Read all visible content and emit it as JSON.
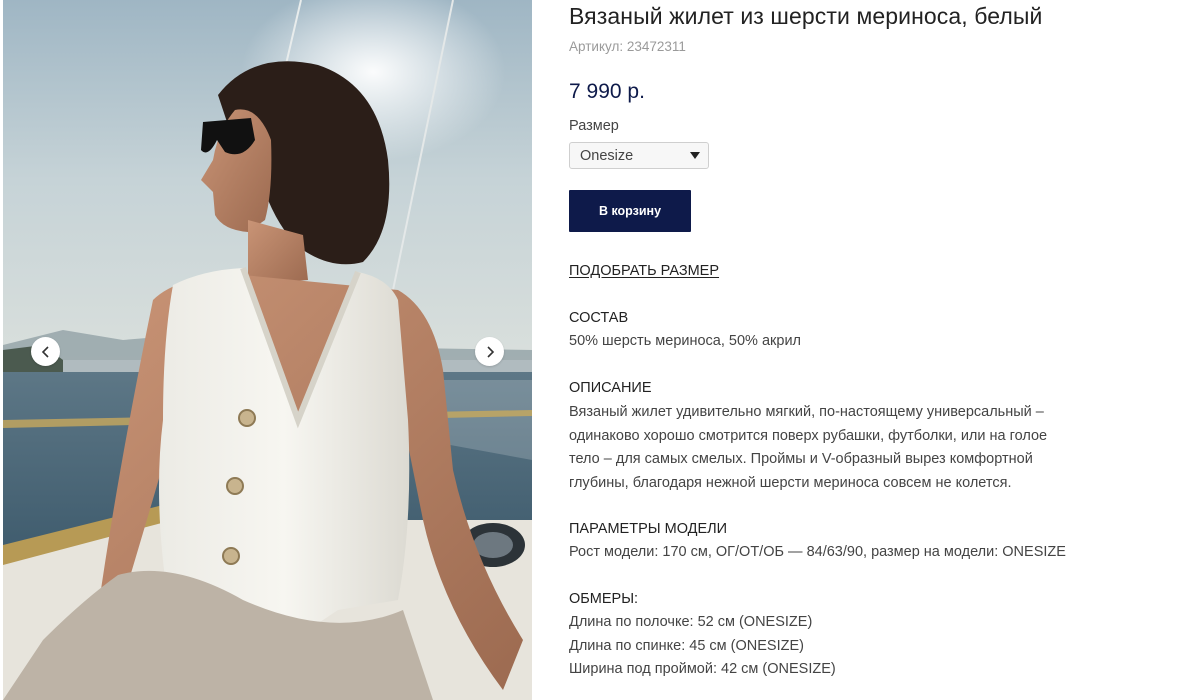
{
  "gallery": {
    "prev_icon": "chevron-left-icon",
    "next_icon": "chevron-right-icon"
  },
  "product": {
    "title": "Вязаный жилет из шерсти мериноса, белый",
    "sku": "Артикул: 23472311",
    "price": "7 990 р.",
    "size_label": "Размер",
    "size_value": "Onesize",
    "cart_label": "В корзину",
    "size_guide_link": "ПОДОБРАТЬ РАЗМЕР"
  },
  "composition": {
    "heading": "СОСТАВ",
    "text": "50% шерсть мериноса, 50% акрил"
  },
  "description": {
    "heading": "ОПИСАНИЕ",
    "lines": [
      "Вязаный жилет удивительно мягкий, по-настоящему универсальный –",
      "одинаково хорошо смотрится поверх рубашки, футболки, или на голое",
      "тело – для самых смелых. Проймы и V-образный вырез комфортной",
      "глубины, благодаря нежной шерсти мериноса совсем не колется."
    ]
  },
  "model": {
    "heading": "ПАРАМЕТРЫ МОДЕЛИ",
    "text": "Рост модели: 170 см, ОГ/ОТ/ОБ — 84/63/90, размер на модели: ONESIZE"
  },
  "measurements": {
    "heading": "ОБМЕРЫ:",
    "lines": [
      "Длина по полочке: 52 см (ONESIZE)",
      "Длина по спинке: 45 см (ONESIZE)",
      "Ширина под проймой: 42 см (ONESIZE)"
    ]
  },
  "colors": {
    "accent": "#0e1a4a",
    "muted_text": "#9a9a9a"
  }
}
